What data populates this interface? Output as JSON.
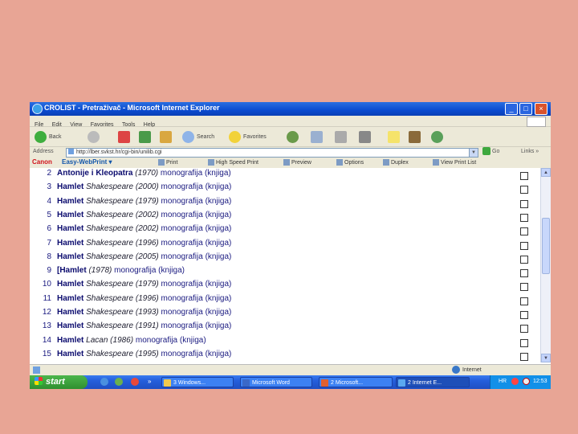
{
  "window": {
    "title": "CROLIST - Pretraživač - Microsoft Internet Explorer",
    "controls": {
      "minimize": "_",
      "maximize": "□",
      "close": "×"
    }
  },
  "menu": [
    "File",
    "Edit",
    "View",
    "Favorites",
    "Tools",
    "Help"
  ],
  "toolbar": {
    "back": "Back",
    "search": "Search",
    "favorites": "Favorites"
  },
  "address": {
    "label": "Address",
    "url": "http://lber.svkst.hr/cgi-bin/unilib.cgi",
    "go": "Go",
    "links": "Links",
    "more": "»"
  },
  "canon_bar": {
    "brand": "Canon",
    "product": "Easy-WebPrint",
    "dropdown": "▾",
    "print": "Print",
    "high_speed": "High Speed Print",
    "preview": "Preview",
    "options": "Options",
    "duplex": "Duplex",
    "view_print_list": "View Print List"
  },
  "results": [
    {
      "n": "2",
      "title": "Antonije i Kleopatra",
      "author": "",
      "year": "(1970)",
      "type": "monografija (knjiga)"
    },
    {
      "n": "3",
      "title": "Hamlet",
      "author": "Shakespeare",
      "year": "(2000)",
      "type": "monografija (knjiga)"
    },
    {
      "n": "4",
      "title": "Hamlet",
      "author": "Shakespeare",
      "year": "(1979)",
      "type": "monografija (knjiga)"
    },
    {
      "n": "5",
      "title": "Hamlet",
      "author": "Shakespeare",
      "year": "(2002)",
      "type": "monografija (knjiga)"
    },
    {
      "n": "6",
      "title": "Hamlet",
      "author": "Shakespeare",
      "year": "(2002)",
      "type": "monografija (knjiga)"
    },
    {
      "n": "7",
      "title": "Hamlet",
      "author": "Shakespeare",
      "year": "(1996)",
      "type": "monografija (knjiga)"
    },
    {
      "n": "8",
      "title": "Hamlet",
      "author": "Shakespeare",
      "year": "(2005)",
      "type": "monografija (knjiga)"
    },
    {
      "n": "9",
      "title": "[Hamlet",
      "author": "",
      "year": "(1978)",
      "type": "monografija (knjiga)"
    },
    {
      "n": "10",
      "title": "Hamlet",
      "author": "Shakespeare",
      "year": "(1979)",
      "type": "monografija (knjiga)"
    },
    {
      "n": "11",
      "title": "Hamlet",
      "author": "Shakespeare",
      "year": "(1996)",
      "type": "monografija (knjiga)"
    },
    {
      "n": "12",
      "title": "Hamlet",
      "author": "Shakespeare",
      "year": "(1993)",
      "type": "monografija (knjiga)"
    },
    {
      "n": "13",
      "title": "Hamlet",
      "author": "Shakespeare",
      "year": "(1991)",
      "type": "monografija (knjiga)"
    },
    {
      "n": "14",
      "title": "Hamlet",
      "author": "Lacan",
      "year": "(1986)",
      "type": "monografija (knjiga)"
    },
    {
      "n": "15",
      "title": "Hamlet",
      "author": "Shakespeare",
      "year": "(1995)",
      "type": "monografija (knjiga)"
    }
  ],
  "status": {
    "zone": "Internet"
  },
  "taskbar": {
    "start": "start",
    "more": "»",
    "tasks": [
      "3 Windows...",
      "Microsoft Word",
      "2 Microsoft...",
      "2 Internet E..."
    ],
    "lang": "HR",
    "clock": "12:53"
  },
  "colors": {
    "desktop": "#e8a595",
    "titlebar": "#0a4bd0",
    "taskbar": "#245edb",
    "start": "#2f8f2f",
    "link": "#0b0b6e"
  }
}
